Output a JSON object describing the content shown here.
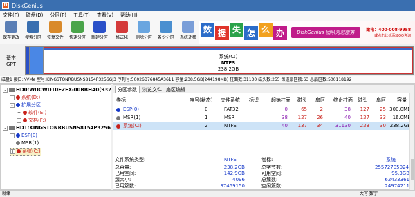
{
  "window": {
    "title": "DiskGenius",
    "app_icon": "D"
  },
  "menu": [
    "文件(F)",
    "磁盘(D)",
    "分区(P)",
    "工具(T)",
    "查看(V)",
    "帮助(H)"
  ],
  "toolbar": [
    {
      "label": "保存更改",
      "icon": "save-icon",
      "color": "#5b7fb5"
    },
    {
      "label": "搜索分区",
      "icon": "search-icon",
      "color": "#3a6fb0"
    },
    {
      "label": "恢复文件",
      "icon": "recover-icon",
      "color": "#d98a2b"
    },
    {
      "label": "快速分区",
      "icon": "quick-partition-icon",
      "color": "#4aa44a"
    },
    {
      "label": "新建分区",
      "icon": "new-partition-icon",
      "color": "#2a50c8"
    },
    {
      "label": "格式化",
      "icon": "format-icon",
      "color": "#d43a3a"
    },
    {
      "label": "删除分区",
      "icon": "delete-icon",
      "color": "#6aa6e0"
    },
    {
      "label": "备份分区",
      "icon": "backup-icon",
      "color": "#4a8fd0"
    },
    {
      "label": "系统迁移",
      "icon": "migrate-icon",
      "color": "#7a9ed8"
    }
  ],
  "ad": {
    "chars": [
      {
        "ch": "数",
        "color": "#2b6cc9"
      },
      {
        "ch": "据",
        "color": "#e0342b"
      },
      {
        "ch": "失",
        "color": "#2aa24a"
      },
      {
        "ch": "怎",
        "color": "#2b6cc9"
      },
      {
        "ch": "么",
        "color": "#f2a11e"
      },
      {
        "ch": "办",
        "color": "#c01c8a"
      }
    ],
    "slogan": "DiskGenius 团队为您服务",
    "tel": "致电：400-008-9958",
    "sub": "或点击此处添加QQ咨询"
  },
  "diskmap": {
    "type_label": "基本",
    "scheme": "GPT",
    "partition_name": "系统(C:)",
    "fs": "NTFS",
    "size": "238.2GB"
  },
  "infoline": "磁盘1 接口:NVMe  型号:KINGSTONRBUSNS8154P3256GJ3  序列号:50026B76845A3611  容量:238.5GB(244198MB)  柱面数:31130  磁头数:255  每道扇区数:63  总扇区数:500118192",
  "tree": [
    {
      "label": "HD0:WDCWD10EZEX-00BBHA0(932G",
      "level": 0,
      "kind": "disk",
      "expand": "-",
      "color": "#000"
    },
    {
      "label": "系统(D:)",
      "level": 1,
      "kind": "part",
      "expand": "+",
      "color": "#c8211a"
    },
    {
      "label": "扩展分区",
      "level": 1,
      "kind": "part",
      "expand": "-",
      "color": "#1538c8"
    },
    {
      "label": "软件(E:)",
      "level": 2,
      "kind": "part",
      "expand": "+",
      "color": "#c8211a"
    },
    {
      "label": "文档(F:)",
      "level": 2,
      "kind": "part",
      "expand": "+",
      "color": "#c8211a"
    },
    {
      "label": "HD1:KINGSTONRBUSNS8154P3256GJ",
      "level": 0,
      "kind": "disk",
      "expand": "-",
      "color": "#000"
    },
    {
      "label": "ESP(0)",
      "level": 1,
      "kind": "part",
      "expand": "+",
      "color": "#1538c8"
    },
    {
      "label": "MSR(1)",
      "level": 1,
      "kind": "part",
      "expand": " ",
      "color": "#000"
    },
    {
      "label": "系统(C:)",
      "level": 1,
      "kind": "part",
      "expand": "+",
      "color": "#c8211a",
      "selected": true
    }
  ],
  "tabs": [
    "分区参数",
    "浏览文件",
    "扇区编辑"
  ],
  "table": {
    "headers": [
      "卷标",
      "序号(状态)",
      "文件系统",
      "标识",
      "起始柱面",
      "磁头",
      "扇区",
      "终止柱面",
      "磁头",
      "扇区",
      "容量"
    ],
    "rows": [
      {
        "name": "ESP(0)",
        "idx": "0",
        "fs": "FAT32",
        "flag": "",
        "sc": "0",
        "sh": "65",
        "ss": "2",
        "ec": "38",
        "eh": "127",
        "es": "25",
        "size": "300.0MB",
        "color": "#1538c8"
      },
      {
        "name": "MSR(1)",
        "idx": "1",
        "fs": "MSR",
        "flag": "",
        "sc": "38",
        "sh": "127",
        "ss": "26",
        "ec": "40",
        "eh": "137",
        "es": "33",
        "size": "16.0MB",
        "color": "#000"
      },
      {
        "name": "系统(C:)",
        "idx": "2",
        "fs": "NTFS",
        "flag": "",
        "sc": "40",
        "sh": "137",
        "ss": "34",
        "ec": "31130",
        "eh": "233",
        "es": "30",
        "size": "238.2GB",
        "color": "#c8211a",
        "selected": true
      }
    ]
  },
  "props": {
    "fs_type_label": "文件系统类型:",
    "fs_type": "NTFS",
    "vol_label_label": "卷标:",
    "vol_label": "系统",
    "rows": [
      {
        "l1": "总容量:",
        "v1": "238.2GB",
        "l2": "总字节数:",
        "v2": "255727050240"
      },
      {
        "l1": "已用空间:",
        "v1": "142.9GB",
        "l2": "可用空间:",
        "v2": "95.3GB"
      },
      {
        "l1": "簇大小:",
        "v1": "4096",
        "l2": "总簇数:",
        "v2": "62433361"
      },
      {
        "l1": "已用簇数:",
        "v1": "37459150",
        "l2": "空闲簇数:",
        "v2": "24974211"
      }
    ]
  },
  "status": {
    "left": "就绪",
    "right": "大写  数字"
  }
}
